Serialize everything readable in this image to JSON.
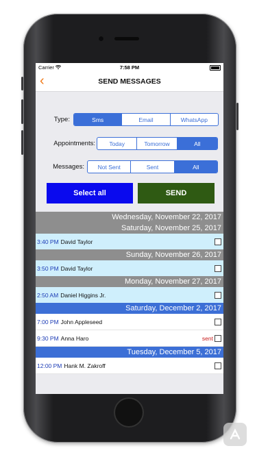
{
  "status_bar": {
    "carrier": "Carrier",
    "time": "7:58 PM"
  },
  "nav": {
    "back_icon": "chevron-left-icon",
    "title": "SEND MESSAGES"
  },
  "filters": {
    "type": {
      "label": "Type:",
      "options": [
        "Sms",
        "Email",
        "WhatsApp"
      ],
      "selected": "Sms"
    },
    "appointments": {
      "label": "Appointments:",
      "options": [
        "Today",
        "Tomorrow",
        "All"
      ],
      "selected": "All"
    },
    "messages": {
      "label": "Messages:",
      "options": [
        "Not Sent",
        "Sent",
        "All"
      ],
      "selected": "All"
    }
  },
  "actions": {
    "select_all": "Select all",
    "send": "SEND"
  },
  "colors": {
    "accent": "#3b6fd8",
    "select_all": "#0a0aee",
    "send": "#2f5a13",
    "back": "#f07a1a",
    "sent": "#c81d1d"
  },
  "list": [
    {
      "kind": "date",
      "text": "Wednesday, November 22, 2017",
      "style": "gray"
    },
    {
      "kind": "date",
      "text": "Saturday, November 25, 2017",
      "style": "gray"
    },
    {
      "kind": "row",
      "time": "3:40 PM",
      "name": "David Taylor",
      "status": "",
      "style": "cyan"
    },
    {
      "kind": "date",
      "text": "Sunday, November 26, 2017",
      "style": "gray"
    },
    {
      "kind": "row",
      "time": "3:50 PM",
      "name": "David Taylor",
      "status": "",
      "style": "cyan"
    },
    {
      "kind": "date",
      "text": "Monday, November 27, 2017",
      "style": "gray"
    },
    {
      "kind": "row",
      "time": "2:50 AM",
      "name": "Daniel Higgins Jr.",
      "status": "",
      "style": "cyan"
    },
    {
      "kind": "date",
      "text": "Saturday, December 2, 2017",
      "style": "blue"
    },
    {
      "kind": "row",
      "time": "7:00 PM",
      "name": "John Appleseed",
      "status": "",
      "style": "white"
    },
    {
      "kind": "row",
      "time": "9:30 PM",
      "name": "Anna Haro",
      "status": "sent",
      "style": "white"
    },
    {
      "kind": "date",
      "text": "Tuesday, December 5, 2017",
      "style": "blue"
    },
    {
      "kind": "row",
      "time": "12:00 PM",
      "name": "Hank M. Zakroff",
      "status": "",
      "style": "white"
    }
  ]
}
